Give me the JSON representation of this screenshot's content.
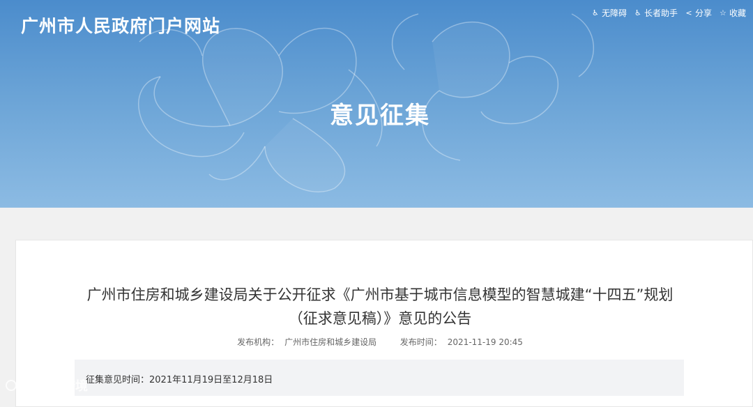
{
  "header": {
    "site_title": "广州市人民政府门户网站",
    "section_title": "意见征集",
    "tools": [
      {
        "label": "无障碍",
        "icon": "accessibility-icon"
      },
      {
        "label": "长者助手",
        "icon": "elder-helper-icon"
      },
      {
        "label": "分享",
        "icon": "share-icon"
      },
      {
        "label": "收藏",
        "icon": "star-icon"
      }
    ]
  },
  "article": {
    "title_line1": "广州市住房和城乡建设局关于公开征求《广州市基于城市信息模型的智慧城建“十四五”规划",
    "title_line2": "（征求意见稿）》意见的公告",
    "publisher_label": "发布机构：",
    "publisher": "广州市住房和城乡建设局",
    "time_label": "发布时间：",
    "time": "2021-11-19 20:45",
    "period_label": "征集意见时间：",
    "period": "2021年11月19日至12月18日"
  },
  "watermark": {
    "text": "大数跨境"
  }
}
